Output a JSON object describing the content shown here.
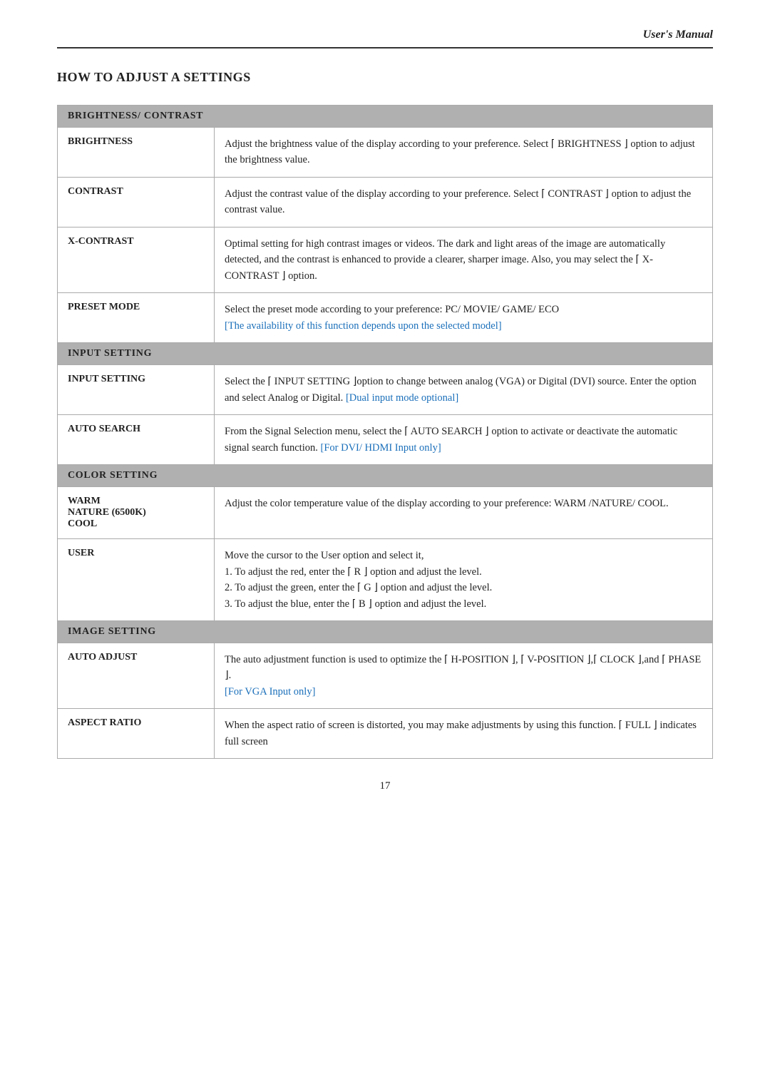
{
  "header": {
    "title": "User's Manual"
  },
  "page_title": "HOW TO ADJUST A SETTINGS",
  "sections": [
    {
      "section_header": "BRIGHTNESS/ CONTRAST",
      "rows": [
        {
          "label": "BRIGHTNESS",
          "description": "Adjust the brightness value of the display according to your preference. Select ⌈ BRIGHTNESS ⌋ option to adjust the brightness value.",
          "has_link": false
        },
        {
          "label": "CONTRAST",
          "description": "Adjust the contrast value of the display according to your preference. Select ⌈ CONTRAST ⌋ option to adjust the contrast value.",
          "has_link": false
        },
        {
          "label": "X-CONTRAST",
          "description": "Optimal setting for high contrast images or videos. The dark and light areas of the image are automatically detected, and the contrast is enhanced to provide a clearer, sharper image. Also, you may select the ⌈ X-CONTRAST ⌋ option.",
          "has_link": false
        },
        {
          "label": "PRESET MODE",
          "description_plain": "Select the preset mode according to your preference: PC/ MOVIE/ GAME/ ECO",
          "description_link": "[The availability of this function depends upon the selected model]",
          "has_link": true
        }
      ]
    },
    {
      "section_header": "INPUT SETTING",
      "rows": [
        {
          "label": "INPUT SETTING",
          "description_plain": "Select the ⌈ INPUT SETTING ⌋option to change between analog (VGA) or Digital (DVI) source. Enter the option and select Analog or Digital.",
          "description_link": "[Dual input mode optional]",
          "has_link": true
        },
        {
          "label": "AUTO SEARCH",
          "description_plain": "From the Signal Selection menu, select the  ⌈ AUTO SEARCH ⌋ option to activate or deactivate the automatic signal search function.",
          "description_link": "[For DVI/ HDMI Input only]",
          "has_link": true
        }
      ]
    },
    {
      "section_header": "COLOR SETTING",
      "rows": [
        {
          "label": "WARM\nNATURE (6500K)\nCOOL",
          "description": "Adjust the color temperature value of the display according to your preference: WARM /NATURE/ COOL.",
          "has_link": false
        },
        {
          "label": "USER",
          "description": "Move the cursor to the User option and select it,\n1. To adjust the red, enter the ⌈ R ⌋ option and adjust the level.\n2. To adjust the green, enter the ⌈ G ⌋ option and adjust the level.\n3. To adjust the blue, enter the ⌈ B ⌋ option and adjust the level.",
          "has_link": false
        }
      ]
    },
    {
      "section_header": "IMAGE SETTING",
      "rows": [
        {
          "label": "AUTO ADJUST",
          "description_plain": "The auto adjustment function is used to optimize the ⌈ H-POSITION ⌋, ⌈ V-POSITION ⌋,⌈ CLOCK ⌋,and ⌈ PHASE ⌋.",
          "description_link": "[For VGA Input only]",
          "has_link": true
        },
        {
          "label": "ASPECT RATIO",
          "description": "When the aspect ratio of screen is distorted, you may make adjustments by using this function. ⌈ FULL ⌋ indicates full screen",
          "has_link": false
        }
      ]
    }
  ],
  "footer": {
    "page_number": "17"
  }
}
